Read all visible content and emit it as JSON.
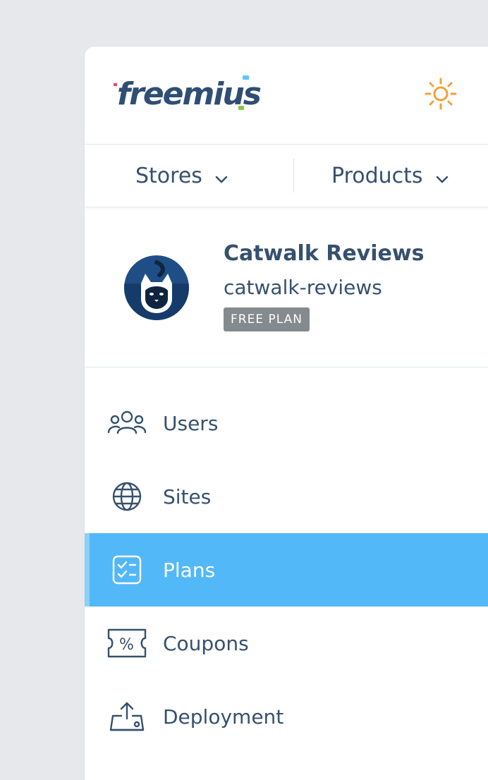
{
  "brand": {
    "logo_text": "freemius"
  },
  "colors": {
    "accent": "#52b8f8",
    "text": "#36506e",
    "sun": "#f0a23a",
    "badge": "#848a8e"
  },
  "icons": {
    "theme": "sun-icon",
    "dropdown": "chevron-down-icon"
  },
  "switcher": {
    "stores_label": "Stores",
    "products_label": "Products"
  },
  "product": {
    "name": "Catwalk Reviews",
    "slug": "catwalk-reviews",
    "plan_badge": "FREE PLAN"
  },
  "nav": {
    "items": [
      {
        "label": "Users",
        "icon": "users-icon",
        "active": false
      },
      {
        "label": "Sites",
        "icon": "globe-icon",
        "active": false
      },
      {
        "label": "Plans",
        "icon": "checklist-icon",
        "active": true
      },
      {
        "label": "Coupons",
        "icon": "coupon-icon",
        "active": false
      },
      {
        "label": "Deployment",
        "icon": "upload-icon",
        "active": false
      }
    ]
  }
}
